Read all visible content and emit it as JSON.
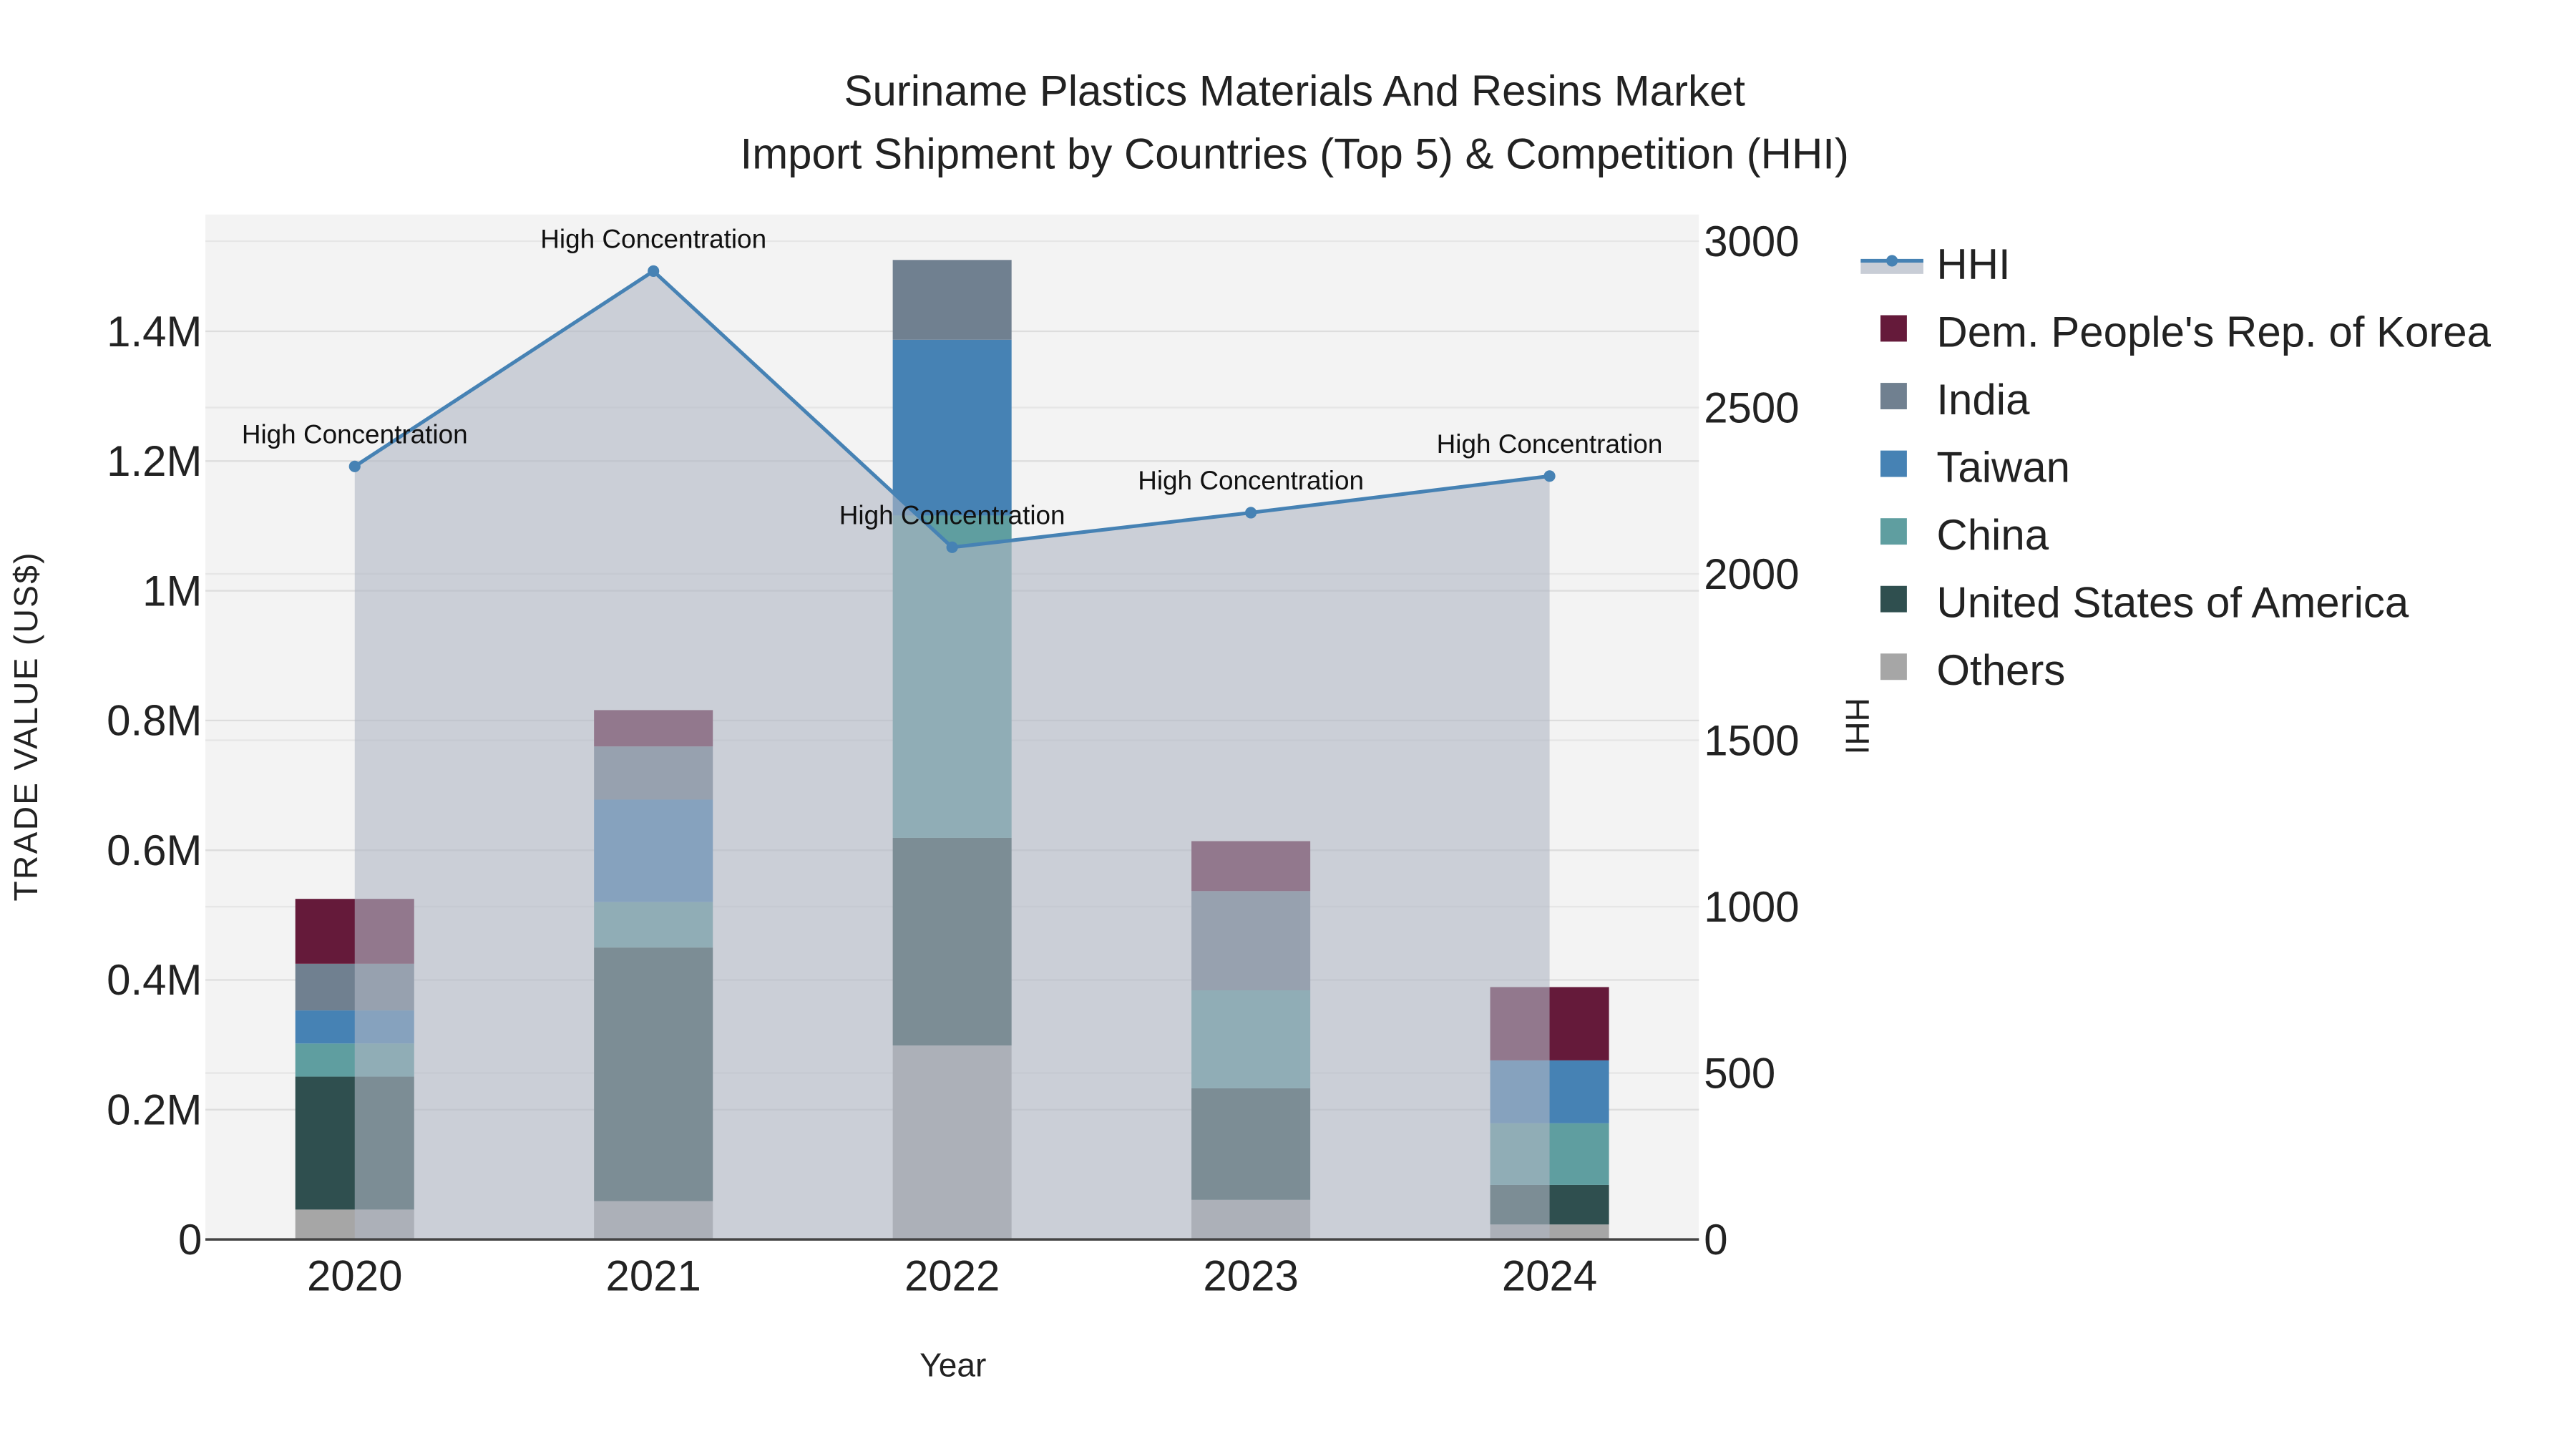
{
  "chart_data": {
    "type": "bar",
    "title": "Suriname Plastics Materials And Resins Market",
    "subtitle": "Import Shipment by Countries (Top 5) & Competition (HHI)",
    "xlabel": "Year",
    "ylabel": "TRADE VALUE (US$)",
    "y2label": "HHI",
    "categories": [
      "2020",
      "2021",
      "2022",
      "2023",
      "2024"
    ],
    "ylim": [
      0,
      1580000
    ],
    "y2lim": [
      0,
      3080
    ],
    "yticks": [
      0,
      200000,
      400000,
      600000,
      800000,
      1000000,
      1200000,
      1400000
    ],
    "ytick_labels": [
      "0",
      "0.2M",
      "0.4M",
      "0.6M",
      "0.8M",
      "1M",
      "1.2M",
      "1.4M"
    ],
    "y2ticks": [
      0,
      500,
      1000,
      1500,
      2000,
      2500,
      3000
    ],
    "y2tick_labels": [
      "0",
      "500",
      "1000",
      "1500",
      "2000",
      "2500",
      "3000"
    ],
    "stacked": true,
    "series": [
      {
        "name": "Others",
        "color": "#a6a6a6",
        "values": [
          46000,
          59000,
          299000,
          61000,
          23000
        ]
      },
      {
        "name": "United States of America",
        "color": "#2f4f4f",
        "values": [
          205000,
          391000,
          320000,
          172000,
          61000
        ]
      },
      {
        "name": "China",
        "color": "#5f9ea0",
        "values": [
          51000,
          70000,
          497000,
          151000,
          95000
        ]
      },
      {
        "name": "Taiwan",
        "color": "#4682b4",
        "values": [
          51000,
          158000,
          271000,
          0,
          97000
        ]
      },
      {
        "name": "India",
        "color": "#708090",
        "values": [
          72000,
          82000,
          123000,
          153000,
          0
        ]
      },
      {
        "name": "Dem. People's Rep. of Korea",
        "color": "#651a3a",
        "values": [
          100000,
          56000,
          0,
          77000,
          113000
        ]
      }
    ],
    "hhi": {
      "name": "HHI",
      "color": "#4682b4",
      "values": [
        2323,
        2910,
        2080,
        2184,
        2294
      ],
      "annotations": [
        "High Concentration",
        "High Concentration",
        "High Concentration",
        "High Concentration",
        "High Concentration"
      ]
    },
    "legend_order": [
      "HHI",
      "Dem. People's Rep. of Korea",
      "India",
      "Taiwan",
      "China",
      "United States of America",
      "Others"
    ],
    "legend_position": "right",
    "grid": true
  }
}
